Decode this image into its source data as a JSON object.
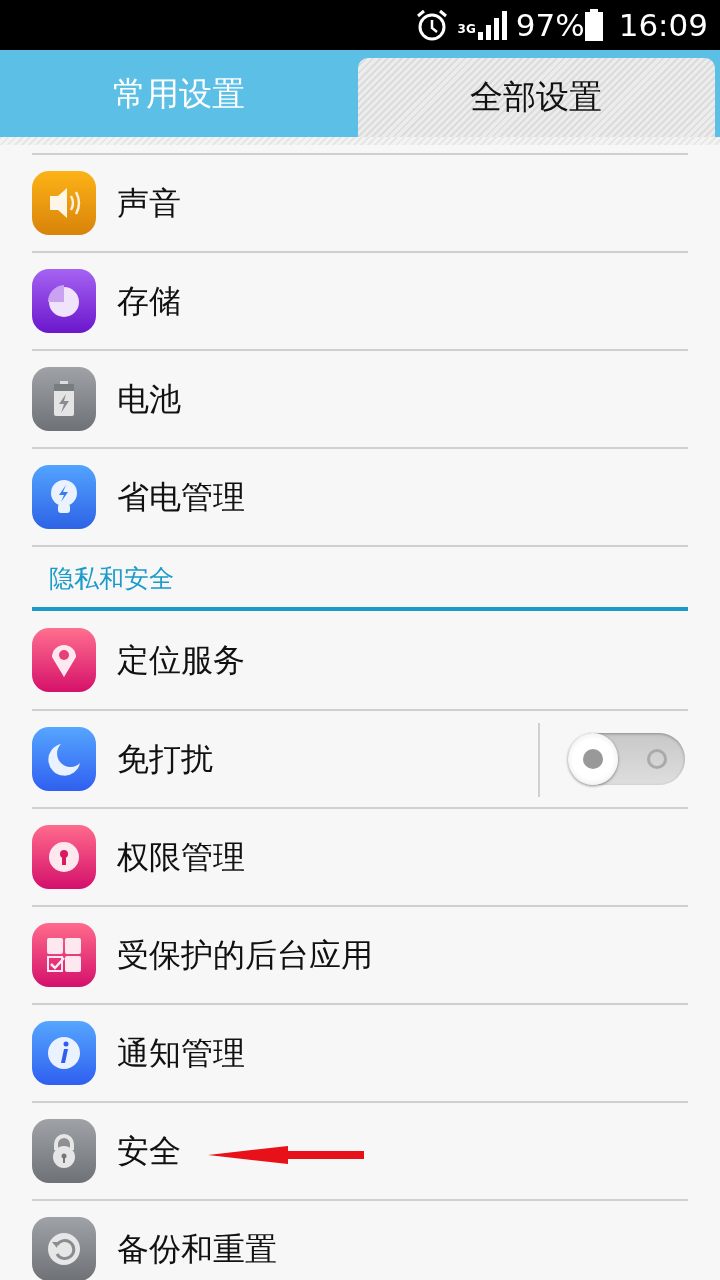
{
  "status_bar": {
    "network": "3G",
    "battery": "97%",
    "time": "16:09"
  },
  "tabs": [
    {
      "label": "常用设置",
      "selected": false
    },
    {
      "label": "全部设置",
      "selected": true
    }
  ],
  "sections": [
    {
      "items": [
        {
          "label": "声音",
          "kind": "link"
        },
        {
          "label": "存储",
          "kind": "link"
        },
        {
          "label": "电池",
          "kind": "link"
        },
        {
          "label": "省电管理",
          "kind": "link"
        }
      ]
    },
    {
      "header": "隐私和安全",
      "items": [
        {
          "label": "定位服务",
          "kind": "link"
        },
        {
          "label": "免打扰",
          "kind": "switch",
          "on": false
        },
        {
          "label": "权限管理",
          "kind": "link"
        },
        {
          "label": "受保护的后台应用",
          "kind": "link"
        },
        {
          "label": "通知管理",
          "kind": "link"
        },
        {
          "label": "安全",
          "kind": "link"
        },
        {
          "label": "备份和重置",
          "kind": "link"
        }
      ]
    }
  ]
}
